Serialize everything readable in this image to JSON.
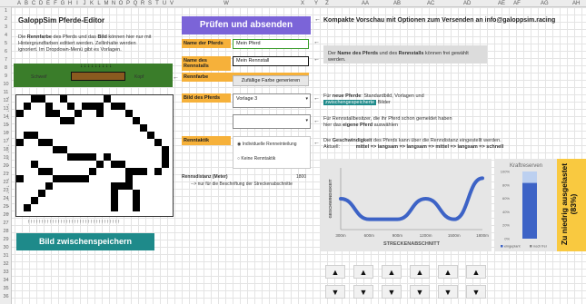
{
  "columns": [
    "A",
    "B",
    "C",
    "D",
    "E",
    "F",
    "G",
    "H",
    "I",
    "J",
    "K",
    "L",
    "M",
    "N",
    "O",
    "P",
    "Q",
    "R",
    "S",
    "T",
    "U",
    "V",
    "W",
    "X",
    "Y",
    "Z",
    "AA",
    "AB",
    "AC",
    "AD",
    "AE",
    "AF",
    "AG",
    "AH"
  ],
  "rows": [
    "1",
    "2",
    "3",
    "4",
    "5",
    "6",
    "7",
    "8",
    "9",
    "10",
    "11",
    "12",
    "13",
    "14",
    "15",
    "16",
    "17",
    "18",
    "19",
    "20",
    "21",
    "22",
    "23",
    "24",
    "25",
    "26",
    "27",
    "28",
    "29",
    "30",
    "31",
    "32",
    "33",
    "34",
    "35",
    "36"
  ],
  "left": {
    "title": "GaloppSim Pferde-Editor",
    "intro_1": "Die ",
    "intro_bold_1": "Rennfarbe",
    "intro_2": " des Pferds und das ",
    "intro_bold_2": "Bild",
    "intro_3": " können hier nur mit",
    "intro_line2": "Hintergrundfarben editiert werden. Zellinhalte werden",
    "intro_line3": "ignoriert. Im Dropdown-Menü gibt es Vorlagen.",
    "color_arrows": "↓↓↓↓↓↓↓↓↓",
    "color_left": "Schweif",
    "color_right": "Kopf",
    "row_arrow": "→",
    "bottom_arrows": "↑↑↑↑↑↑↑↑↑↑↑↑↑↑↑↑↑↑↑↑↑↑↑↑↑↑↑↑↑↑↑↑↑↑",
    "save_button": "Bild zwischenspeichern"
  },
  "form": {
    "submit_button": "Prüfen und absenden",
    "name_label": "Name der Pferds",
    "name_value": "Mein Pferd",
    "stable_label": "Name des Rennstalls",
    "stable_value": "Mein Rennstall",
    "rennfarbe_label": "Rennfarbe",
    "random_color_button": "Zufällige Farbe generieren",
    "image_label": "Bild des Pferds",
    "image_value": "Vorlage 3",
    "renntaktik_label": "Renntaktik",
    "radio_1": "Individuelle Renneinteilung",
    "radio_2": "Keine Renntaktik",
    "distance_label": "Rennsdistanz (Meter)",
    "distance_value": "1800",
    "distance_note": "--> nur für die Beschriftung der Streckenabschnitte",
    "arrow": "←"
  },
  "right": {
    "header": "Kompakte Vorschau mit Optionen zum Versenden an info@galoppsim.racing",
    "gray_box_1": "Der ",
    "gray_box_bold_1": "Name des Pferds",
    "gray_box_2": " und des ",
    "gray_box_bold_2": "Rennstalls",
    "gray_box_3": " können frei gewählt werden.",
    "new_horse_1": "Für ",
    "new_horse_bold": "neue Pferde",
    "new_horse_2": ": Standardbild, Vorlagen und",
    "new_horse_tag": "zwischengespeicherte",
    "new_horse_3": " Bilder",
    "owner_line1": "Für Rennstallbesitzer, die ihr Pferd schon gemeldet haben",
    "owner_line2a": "hier das ",
    "owner_line2_bold": "eigene Pferd",
    "owner_line2b": " auswählen",
    "speed_line1a": "Die ",
    "speed_line1_bold": "Geschwindigkeit",
    "speed_line1b": " des Pferds kann über die Renndistanz eingestellt werden.",
    "speed_line2_label": "Aktuell:",
    "speed_line2_value": "mittel => langsam => langsam => mittel => langsam => schnell",
    "kraft_title": "Kraftreserven",
    "kraft_legend_1": "eingeplant",
    "kraft_legend_2": "noch frei",
    "warning": "Zu niedrig ausgelastet (83%)"
  },
  "chart_data": [
    {
      "type": "line",
      "title": "",
      "xlabel": "STRECKENABSCHNITT",
      "ylabel": "GESCHWINDIGKEIT",
      "x": [
        "300m",
        "600m",
        "900m",
        "1200m",
        "1500m",
        "1800m"
      ],
      "series": [
        {
          "values": [
            2,
            1,
            1,
            2,
            1,
            3
          ]
        }
      ],
      "color": "#3d63c6",
      "grid": false
    },
    {
      "type": "bar",
      "title": "Kraftreserven",
      "categories": [
        ""
      ],
      "series": [
        {
          "name": "eingeplant",
          "values": [
            83
          ]
        },
        {
          "name": "noch frei",
          "values": [
            17
          ]
        }
      ],
      "yticks": [
        "100%",
        "80%",
        "60%",
        "40%",
        "20%",
        "0%"
      ],
      "ylim": [
        0,
        100
      ],
      "colors": [
        "#3d63c6",
        "#bcd0f0"
      ]
    }
  ],
  "controls": {
    "up": "▲",
    "down": "▼",
    "count": 6
  },
  "colors": {
    "green": "#3a7d2a",
    "teal": "#1e8a8a",
    "purple": "#7b64d8",
    "orange": "#f6b13a",
    "yellow": "#f9c940",
    "blue": "#3d63c6",
    "rennfarbe": "#8a5a1f"
  }
}
